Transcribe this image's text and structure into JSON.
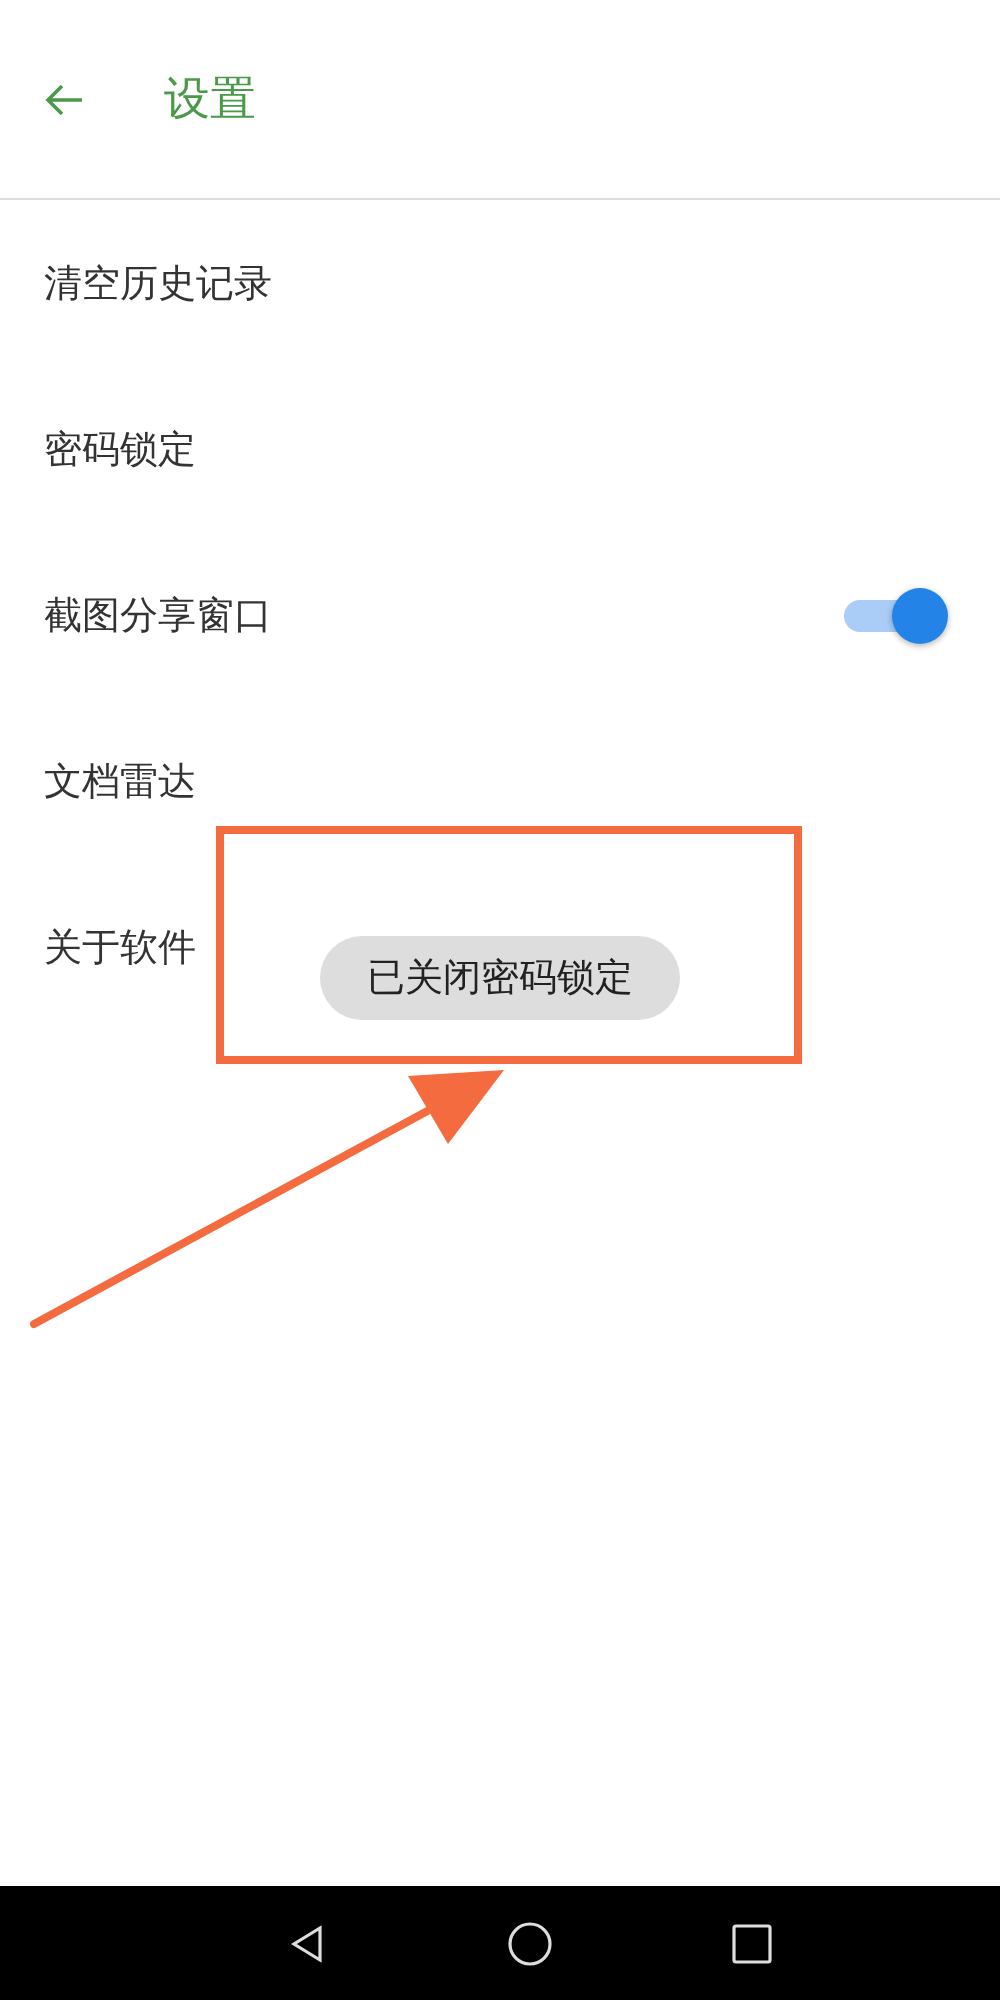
{
  "header": {
    "title": "设置"
  },
  "settings": [
    {
      "kind": "plain",
      "label": "清空历史记录"
    },
    {
      "kind": "plain",
      "label": "密码锁定"
    },
    {
      "kind": "toggle",
      "label": "截图分享窗口",
      "on": true
    },
    {
      "kind": "plain",
      "label": "文档雷达"
    },
    {
      "kind": "plain",
      "label": "关于软件"
    }
  ],
  "toast": "已关闭密码锁定"
}
